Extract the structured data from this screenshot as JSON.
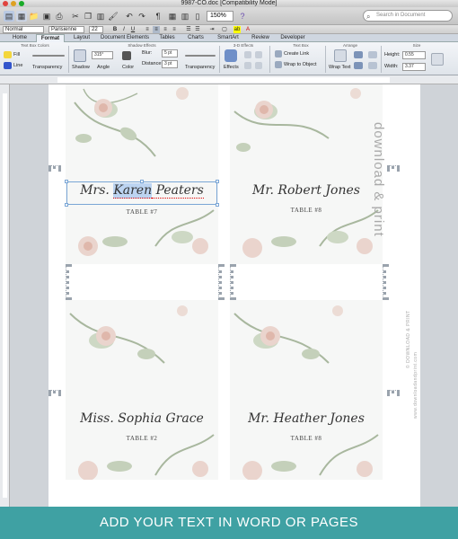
{
  "window": {
    "title": "9987-CO.doc [Compatibility Mode]"
  },
  "toolbar": {
    "zoom": "150%",
    "search_placeholder": "Search in Document"
  },
  "fontbar": {
    "style": "Normal",
    "font": "Parisienne",
    "size": "22"
  },
  "ribbon": {
    "tabs": [
      "Home",
      "Format",
      "Layout",
      "Document Elements",
      "Tables",
      "Charts",
      "SmartArt",
      "Review",
      "Developer"
    ],
    "active_tab": "Format",
    "groups": [
      "Text Box Colors",
      "Shadow Effects",
      "3-D Effects",
      "Text Box",
      "Arrange",
      "Size"
    ],
    "fill_label": "Fill",
    "line_label": "Line",
    "transparency_label": "Transparency",
    "shadow_label": "Shadow",
    "angle_label": "Angle",
    "angle_value": "315°",
    "color_label": "Color",
    "blur_label": "Blur:",
    "blur_value": "5 pt",
    "distance_label": "Distance:",
    "distance_value": "3 pt",
    "transparency2_label": "Transparency",
    "effects_label": "Effects",
    "create_link_label": "Create Link",
    "wrap_to_object_label": "Wrap to Object",
    "wrap_text_label": "Wrap Text",
    "height_label": "Height:",
    "height_value": "0.55",
    "width_label": "Width:",
    "width_value": "3.37"
  },
  "cards": [
    {
      "name": "Mrs. Karen Peaters",
      "name_pre": "Mrs. ",
      "name_sel": "Karen",
      "name_post": " Peaters",
      "table": "TABLE #7"
    },
    {
      "name": "Mr. Robert Jones",
      "table": "TABLE #8"
    },
    {
      "name": "Miss. Sophia Grace",
      "table": "TABLE #2"
    },
    {
      "name": "Mr. Heather Jones",
      "table": "TABLE #8"
    }
  ],
  "side": {
    "brand": "download & print",
    "copyright": "© DOWNLOAD & PRINT",
    "url": "www.downloadandprint.com"
  },
  "banner": {
    "text": "ADD YOUR TEXT IN WORD OR PAGES"
  },
  "colors": {
    "banner": "#3fa1a3",
    "selection": "#bcd4f1",
    "floral_leaf": "#8f9f85",
    "floral_flower": "#d7a79c"
  }
}
